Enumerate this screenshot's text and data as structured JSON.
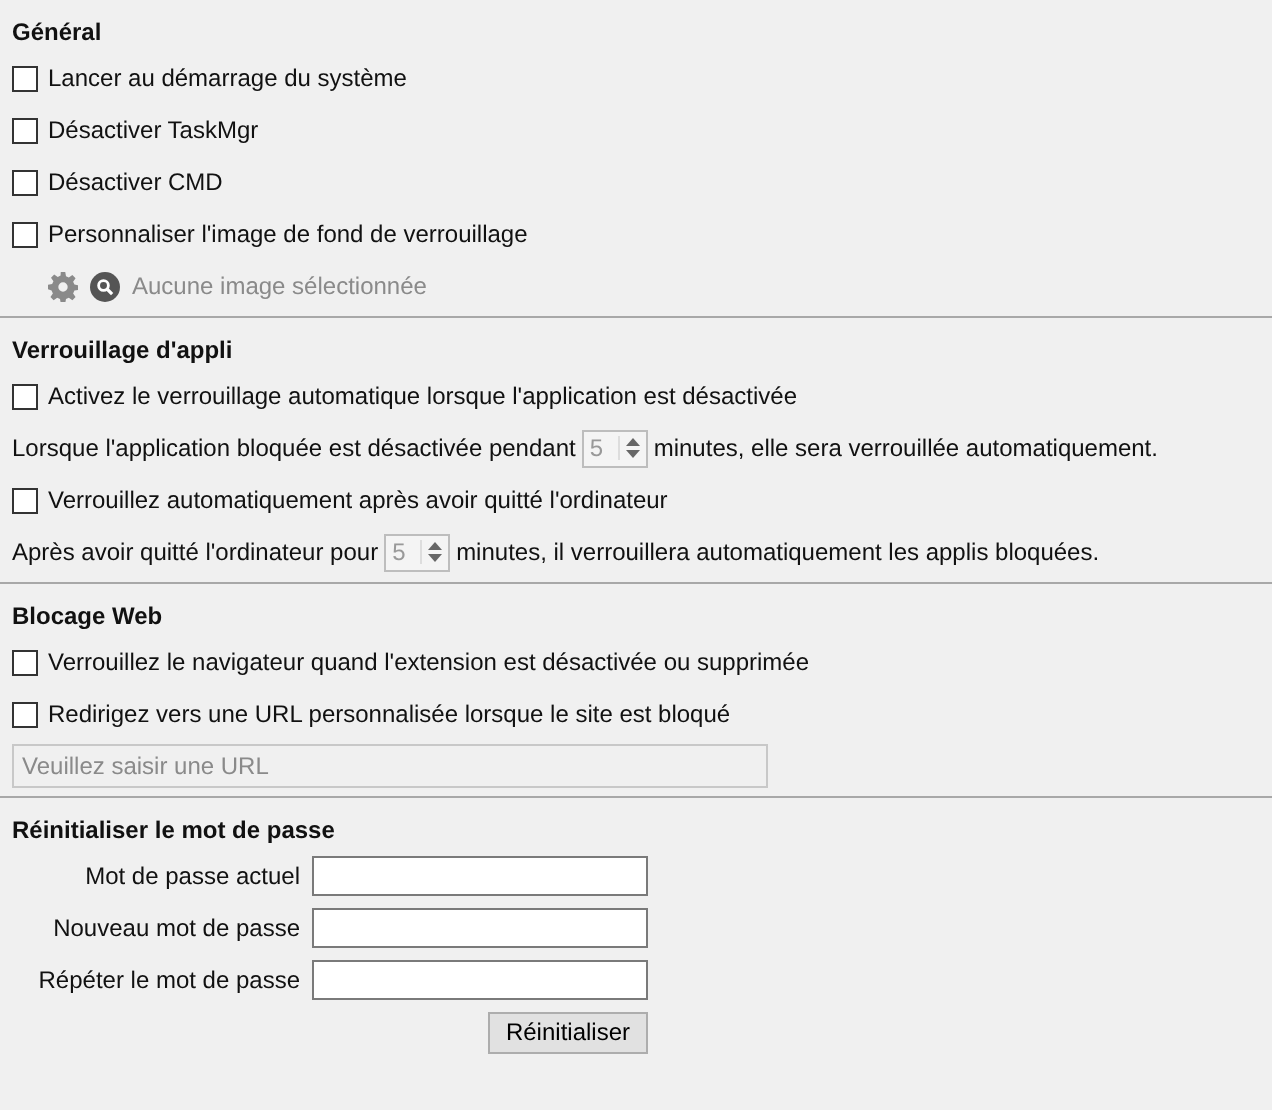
{
  "sections": [
    {
      "title": "Général",
      "items": [
        {
          "kind": "checkbox",
          "label": "Lancer au démarrage du système",
          "checked": false
        },
        {
          "kind": "checkbox",
          "label": "Désactiver TaskMgr",
          "checked": false
        },
        {
          "kind": "checkbox",
          "label": "Désactiver CMD",
          "checked": false
        },
        {
          "kind": "checkbox",
          "label": "Personnaliser l'image de fond de verrouillage",
          "checked": false
        },
        {
          "kind": "image_picker",
          "text": "Aucune image sélectionnée",
          "disabled": true
        }
      ]
    },
    {
      "title": "Verrouillage d'appli",
      "items": [
        {
          "kind": "checkbox",
          "label": "Activez le verrouillage automatique lorsque l'application est désactivée",
          "checked": false
        },
        {
          "kind": "spinner",
          "before": "Lorsque l'application bloquée est désactivée pendant",
          "value": "5",
          "after": "minutes, elle sera verrouillée automatiquement.",
          "disabled": true
        },
        {
          "kind": "checkbox",
          "label": "Verrouillez automatiquement après avoir quitté l'ordinateur",
          "checked": false
        },
        {
          "kind": "spinner",
          "before": "Après avoir quitté l'ordinateur pour",
          "value": "5",
          "after": "minutes, il verrouillera automatiquement les applis bloquées.",
          "disabled": true
        }
      ]
    },
    {
      "title": "Blocage Web",
      "items": [
        {
          "kind": "checkbox",
          "label": "Verrouillez le navigateur quand l'extension est désactivée ou supprimée",
          "checked": false
        },
        {
          "kind": "checkbox",
          "label": "Redirigez vers une URL personnalisée lorsque le site est bloqué",
          "checked": false
        },
        {
          "kind": "url_field",
          "placeholder": "Veuillez saisir une URL",
          "disabled": true
        }
      ]
    },
    {
      "title": "Réinitialiser le mot de passe",
      "items": [
        {
          "kind": "password",
          "label": "Mot de passe actuel"
        },
        {
          "kind": "password",
          "label": "Nouveau mot de passe"
        },
        {
          "kind": "password",
          "label": "Répéter le mot de passe"
        },
        {
          "kind": "button",
          "label": "Réinitialiser"
        }
      ]
    }
  ]
}
